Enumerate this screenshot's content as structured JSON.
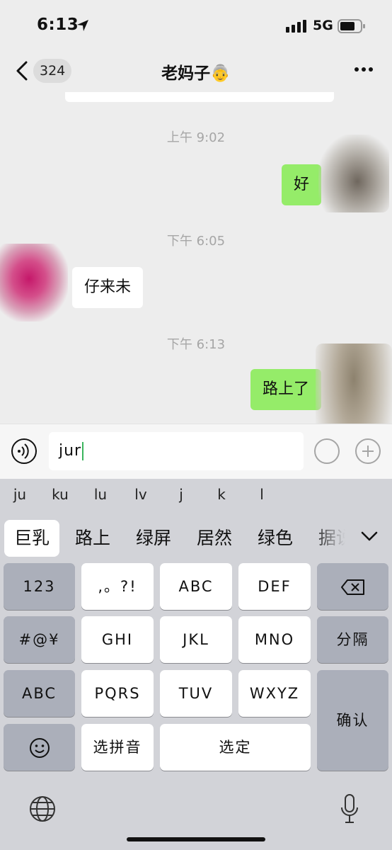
{
  "status_bar": {
    "time": "6:13",
    "network": "5G",
    "icons": [
      "location-arrow-icon",
      "signal-icon",
      "battery-icon"
    ]
  },
  "nav": {
    "back_icon": "chevron-left-icon",
    "unread_count": "324",
    "title": "老妈子",
    "title_emoji": "👵",
    "more_icon": "more-dots-icon"
  },
  "messages": [
    {
      "type": "timestamp",
      "text": "上午 9:02"
    },
    {
      "type": "outgoing",
      "text": "好"
    },
    {
      "type": "timestamp",
      "text": "下午 6:05"
    },
    {
      "type": "incoming",
      "text": "仔来未"
    },
    {
      "type": "timestamp",
      "text": "下午 6:13"
    },
    {
      "type": "outgoing",
      "text": "路上了"
    }
  ],
  "input": {
    "value": "jur",
    "voice_icon": "voice-icon"
  },
  "keyboard": {
    "pinyin_suggestions": [
      "ju",
      "ku",
      "lu",
      "lv",
      "j",
      "k",
      "l"
    ],
    "candidates": [
      "巨乳",
      "路上",
      "绿屏",
      "居然",
      "绿色",
      "据说"
    ],
    "keys": {
      "num": "123",
      "punct": ",。?!",
      "abc_key": "ABC",
      "def": "DEF",
      "symbols": "#@¥",
      "ghi": "GHI",
      "jkl": "JKL",
      "mno": "MNO",
      "separator": "分隔",
      "abc": "ABC",
      "pqrs": "PQRS",
      "tuv": "TUV",
      "wxyz": "WXYZ",
      "confirm": "确认",
      "select_pinyin": "选拼音",
      "select": "选定"
    }
  },
  "colors": {
    "outgoing_bubble": "#95ec69",
    "incoming_bubble": "#ffffff",
    "background": "#ededed",
    "keyboard_bg": "#d2d3d8"
  }
}
